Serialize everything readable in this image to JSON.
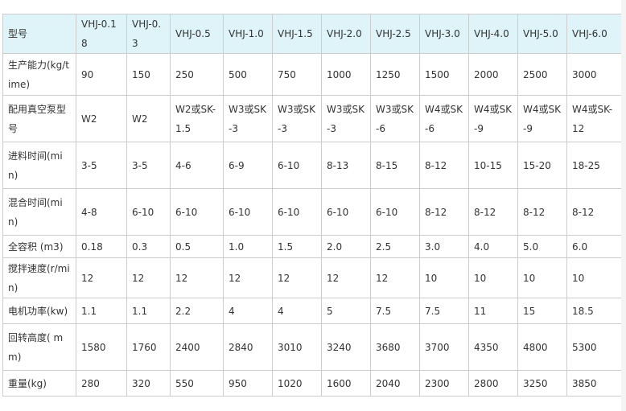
{
  "header": [
    "型号",
    "VHJ-0.18",
    "VHJ-0.3",
    "VHJ-0.5",
    "VHJ-1.0",
    "VHJ-1.5",
    "VHJ-2.0",
    "VHJ-2.5",
    "VHJ-3.0",
    "VHJ-4.0",
    "VHJ-5.0",
    "VHJ-6.0"
  ],
  "rows": [
    [
      "生产能力(kg/time)",
      "90",
      "150",
      "250",
      "500",
      "750",
      "1000",
      "1250",
      "1500",
      "2000",
      "2500",
      "3000"
    ],
    [
      "配用真空泵型号",
      "W2",
      "W2",
      "W2或SK-1.5",
      "W3或SK-3",
      "W3或SK-3",
      "W3或SK-3",
      "W3或SK-6",
      "W4或SK-6",
      "W4或SK-9",
      "W4或SK-9",
      "W4或SK-12"
    ],
    [
      "进料时间(min)",
      "3-5",
      "3-5",
      "4-6",
      "6-9",
      "6-10",
      "8-13",
      "8-15",
      "8-12",
      "10-15",
      "15-20",
      "18-25"
    ],
    [
      "混合时间(min)",
      "4-8",
      "6-10",
      "6-10",
      "6-10",
      "6-10",
      "6-10",
      "6-10",
      "8-12",
      "8-12",
      "8-12",
      "8-12"
    ],
    [
      "全容积 (m3)",
      "0.18",
      "0.3",
      "0.5",
      "1.0",
      "1.5",
      "2.0",
      "2.5",
      "3.0",
      "4.0",
      "5.0",
      "6.0"
    ],
    [
      "搅拌速度(r/min)",
      "12",
      "12",
      "12",
      "12",
      "12",
      "12",
      "12",
      "10",
      "10",
      "10",
      "10"
    ],
    [
      "电机功率(kw)",
      "1.1",
      "1.1",
      "2.2",
      "4",
      "4",
      "5",
      "7.5",
      "7.5",
      "11",
      "15",
      "18.5"
    ],
    [
      "回转高度( mm)",
      "1580",
      "1760",
      "2400",
      "2840",
      "3010",
      "3240",
      "3680",
      "3700",
      "4350",
      "4800",
      "5300"
    ],
    [
      "重量(kg)",
      "280",
      "320",
      "550",
      "950",
      "1020",
      "1600",
      "2040",
      "2300",
      "2800",
      "3250",
      "3850"
    ]
  ]
}
